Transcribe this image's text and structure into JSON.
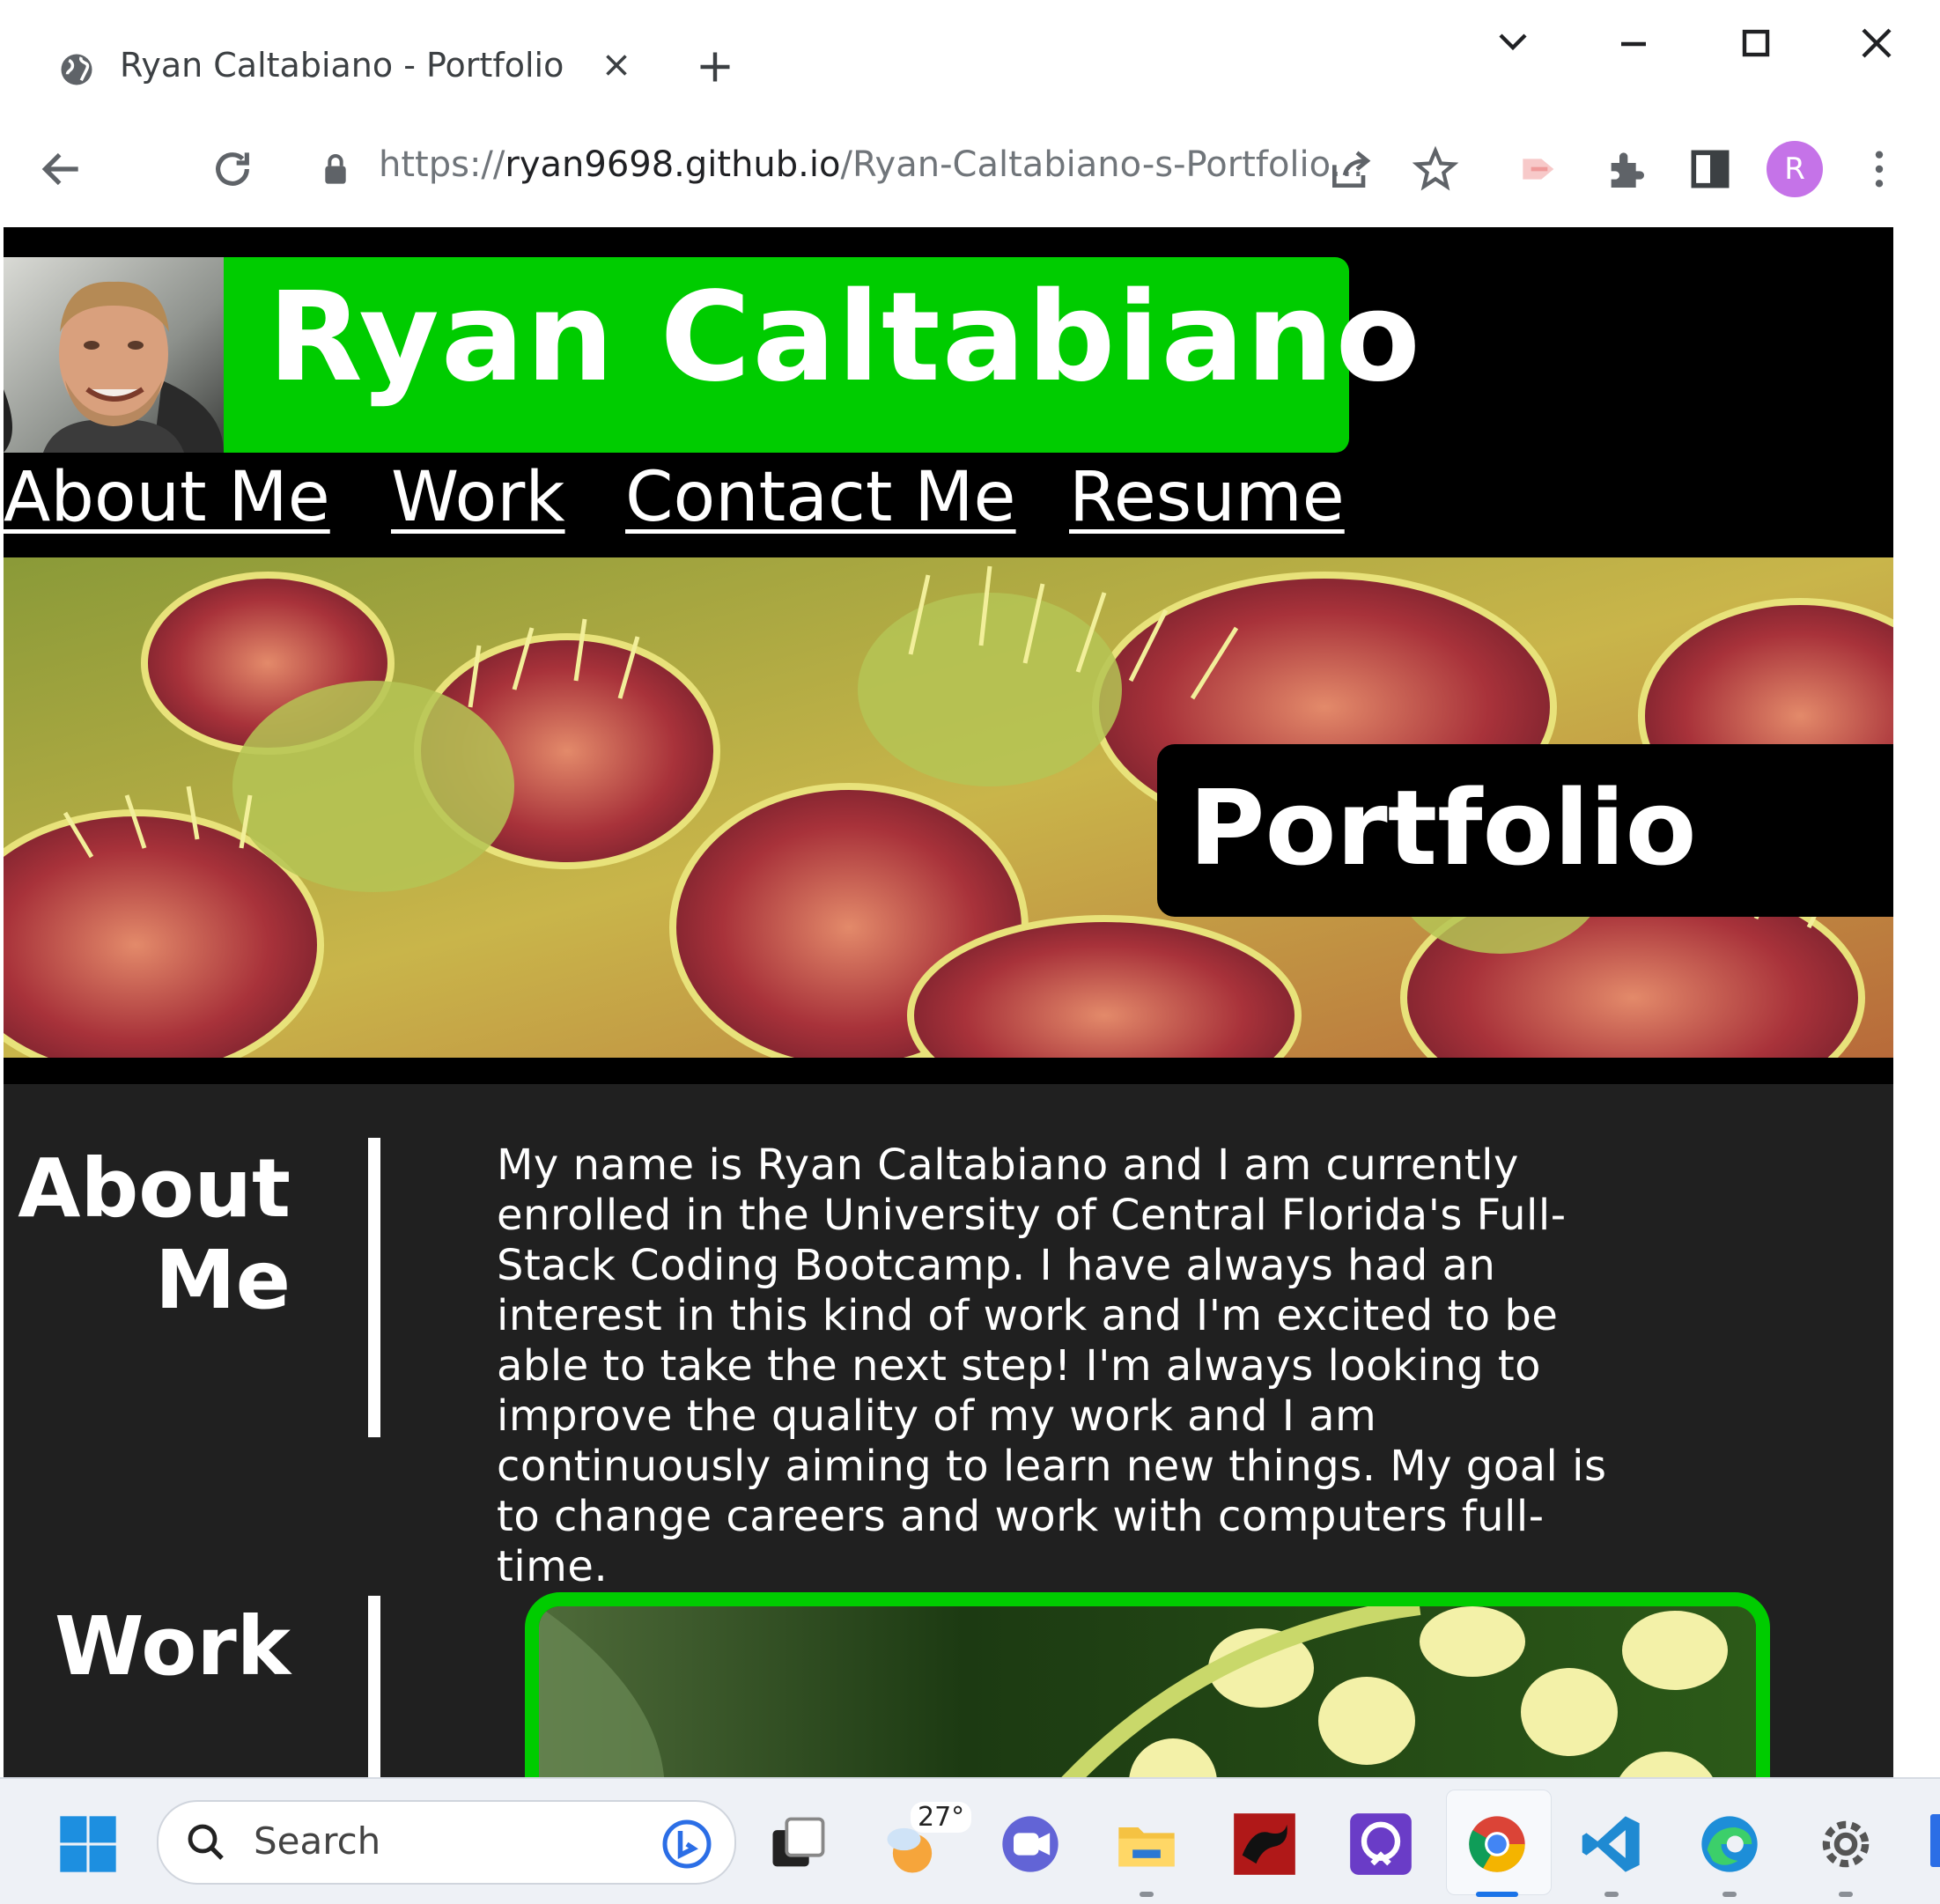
{
  "browser": {
    "tab_title": "Ryan Caltabiano - Portfolio",
    "url_scheme": "https://",
    "url_host": "ryan9698.github.io",
    "url_path": "/Ryan-Caltabiano-s-Portfolio...",
    "profile_initial": "R"
  },
  "site": {
    "name": "Ryan Caltabiano",
    "nav": [
      "About Me",
      "Work",
      "Contact Me",
      "Resume"
    ],
    "hero_label": "Portfolio",
    "about_title_line1": "About",
    "about_title_line2": "Me",
    "about_text": "My name is Ryan Caltabiano and I am currently enrolled in the University of Central Florida's Full-Stack Coding Bootcamp. I have always had an interest in this kind of work and I'm excited to be able to take the next step! I'm always looking to improve the quality of my work and I am continuously aiming to learn new things. My goal is to change careers and work with computers full-time.",
    "work_title": "Work"
  },
  "colors": {
    "accent_green": "#00cc00",
    "page_bg": "#202020",
    "header_bg": "#000000"
  },
  "taskbar": {
    "search_label": "Search",
    "weather_temp": "27°"
  }
}
